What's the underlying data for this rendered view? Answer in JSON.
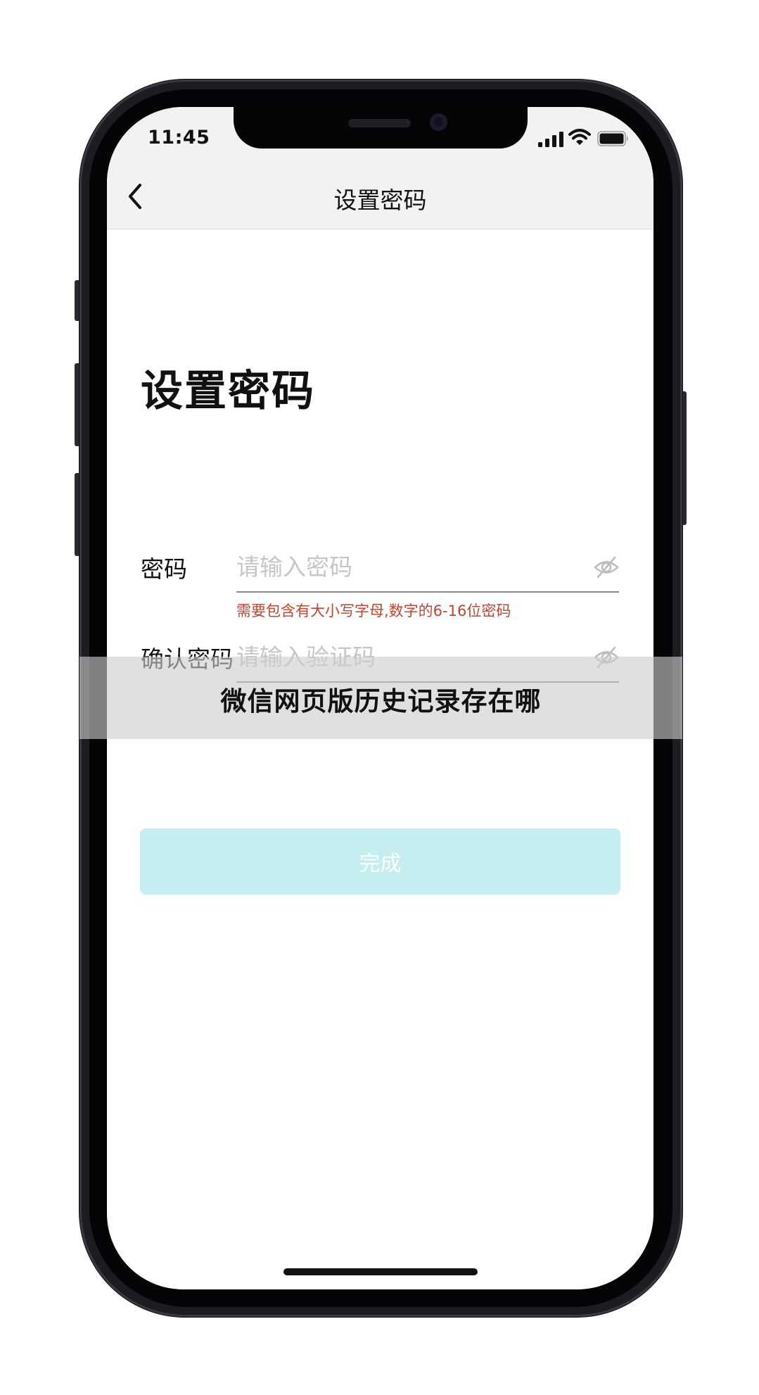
{
  "status_bar": {
    "time": "11:45"
  },
  "nav": {
    "title": "设置密码"
  },
  "main": {
    "heading": "设置密码",
    "password_field": {
      "label": "密码",
      "placeholder": "请输入密码",
      "value": "",
      "hint": "需要包含有大小写字母,数字的6-16位密码"
    },
    "confirm_field": {
      "label": "确认密码",
      "placeholder": "请输入验证码",
      "value": ""
    },
    "submit_label": "完成"
  },
  "watermark": {
    "text": "微信网页版历史记录存在哪"
  },
  "icons": {
    "back": "chevron-left-icon",
    "signal": "cellular-signal-icon",
    "wifi": "wifi-icon",
    "battery": "battery-icon",
    "toggle_visibility": "eye-hidden-icon"
  },
  "colors": {
    "nav_background": "#f2f2f2",
    "hint_red": "#c4452f",
    "submit_disabled": "#c4eef0",
    "placeholder_grey": "#c6c6c6"
  }
}
